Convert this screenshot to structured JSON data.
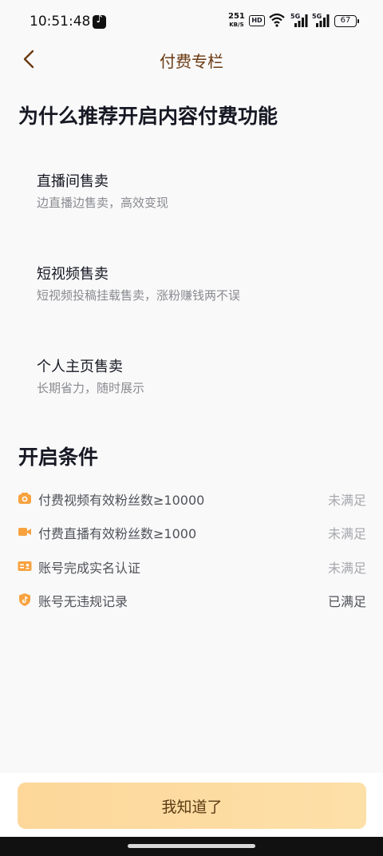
{
  "status_bar": {
    "time": "10:51:48",
    "speed_value": "251",
    "speed_unit": "KB/S",
    "hd_label": "HD",
    "sig1_label": "5G",
    "sig2_label": "5G",
    "battery_level": "67"
  },
  "nav": {
    "title": "付费专栏"
  },
  "why": {
    "heading": "为什么推荐开启内容付费功能",
    "features": [
      {
        "title": "直播间售卖",
        "subtitle": "边直播边售卖，高效变现"
      },
      {
        "title": "短视频售卖",
        "subtitle": "短视频投稿挂载售卖，涨粉赚钱两不误"
      },
      {
        "title": "个人主页售卖",
        "subtitle": "长期省力，随时展示"
      }
    ]
  },
  "conditions": {
    "heading": "开启条件",
    "items": [
      {
        "icon": "camera-icon",
        "label": "付费视频有效粉丝数≥10000",
        "status": "未满足"
      },
      {
        "icon": "video-camera-icon",
        "label": "付费直播有效粉丝数≥1000",
        "status": "未满足"
      },
      {
        "icon": "id-card-icon",
        "label": "账号完成实名认证",
        "status": "未满足"
      },
      {
        "icon": "shield-icon",
        "label": "账号无违规记录",
        "status": "已满足"
      }
    ]
  },
  "footer": {
    "confirm_label": "我知道了"
  },
  "colors": {
    "accent": "#f7a23f",
    "nav_title": "#6b3a12",
    "button_bg": "#fdd79a"
  }
}
